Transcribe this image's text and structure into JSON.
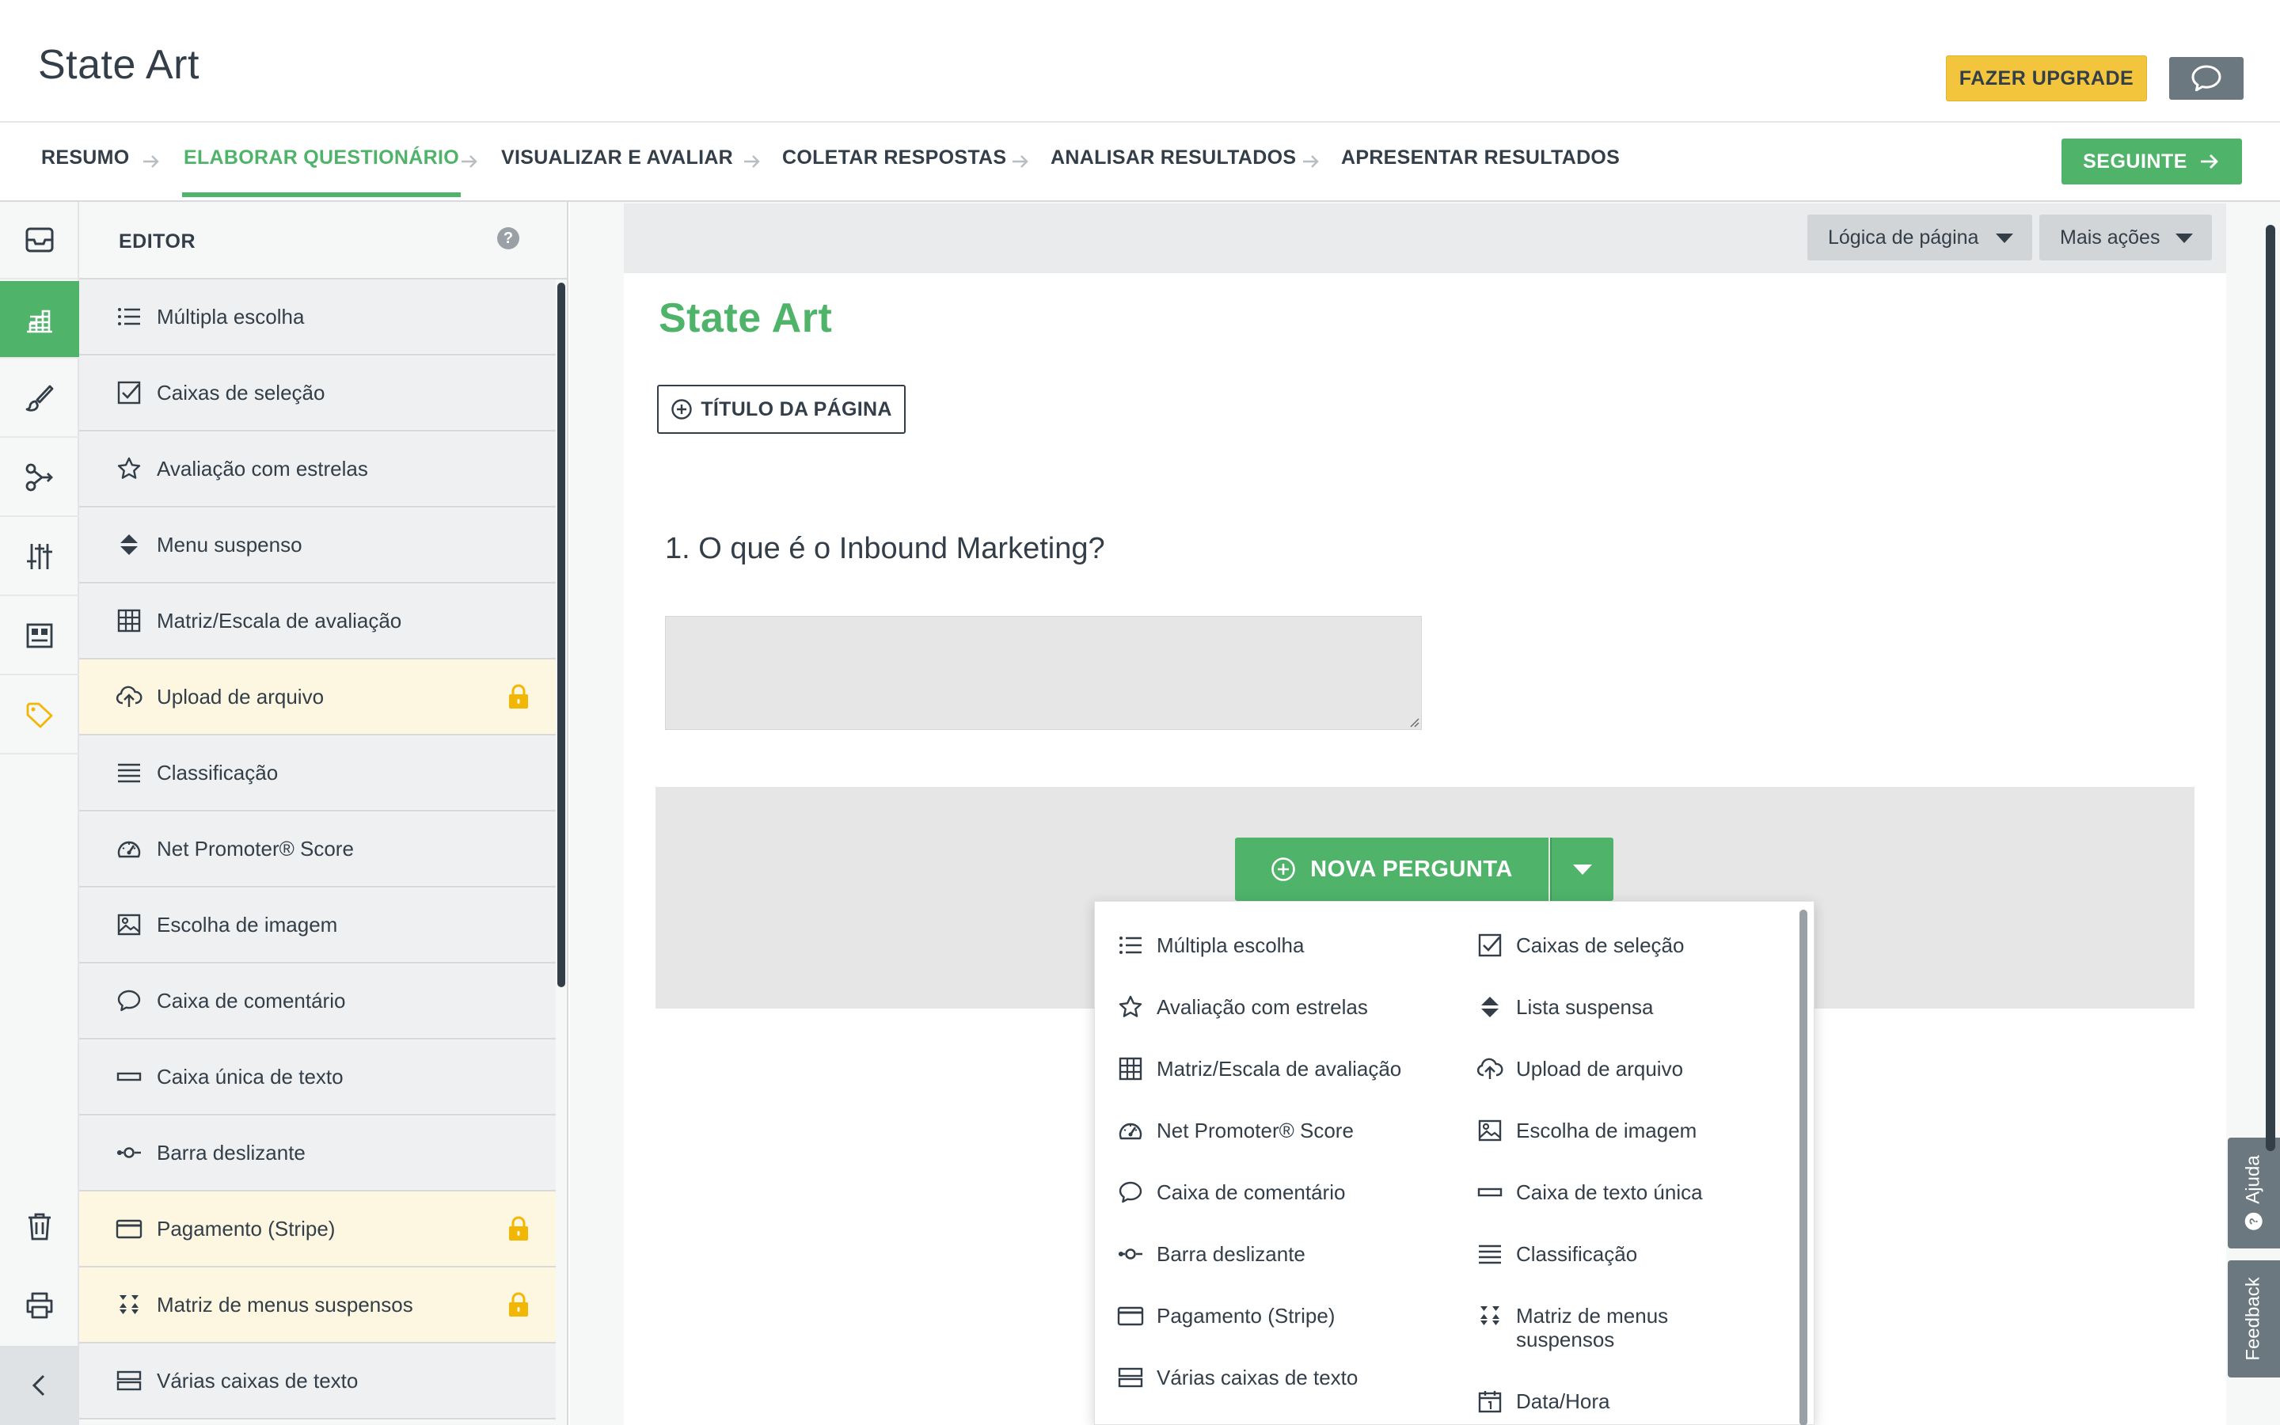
{
  "app": {
    "title": "State Art",
    "upgrade_label": "FAZER UPGRADE",
    "chat_icon": "chat-bubble-icon"
  },
  "steps": [
    {
      "label": "RESUMO",
      "active": false
    },
    {
      "label": "ELABORAR QUESTIONÁRIO",
      "active": true
    },
    {
      "label": "VISUALIZAR E AVALIAR",
      "active": false
    },
    {
      "label": "COLETAR RESPOSTAS",
      "active": false
    },
    {
      "label": "ANALISAR RESULTADOS",
      "active": false
    },
    {
      "label": "APRESENTAR RESULTADOS",
      "active": false
    }
  ],
  "next_label": "SEGUINTE",
  "rail": {
    "items": [
      "inbox-icon",
      "builder-icon",
      "brush-icon",
      "logic-icon",
      "sliders-icon",
      "layout-icon",
      "tag-icon"
    ],
    "bottom": [
      "trash-icon",
      "print-icon",
      "collapse-icon"
    ]
  },
  "editor": {
    "title": "EDITOR",
    "help": "?",
    "items": [
      {
        "label": "Múltipla escolha",
        "icon": "list-icon",
        "locked": false
      },
      {
        "label": "Caixas de seleção",
        "icon": "checkbox-icon",
        "locked": false
      },
      {
        "label": "Avaliação com estrelas",
        "icon": "star-icon",
        "locked": false
      },
      {
        "label": "Menu suspenso",
        "icon": "dropdown-icon",
        "locked": false
      },
      {
        "label": "Matriz/Escala de avaliação",
        "icon": "grid-icon",
        "locked": false
      },
      {
        "label": "Upload de arquivo",
        "icon": "cloud-upload-icon",
        "locked": true
      },
      {
        "label": "Classificação",
        "icon": "ranking-icon",
        "locked": false
      },
      {
        "label": "Net Promoter® Score",
        "icon": "gauge-icon",
        "locked": false
      },
      {
        "label": "Escolha de imagem",
        "icon": "image-icon",
        "locked": false
      },
      {
        "label": "Caixa de comentário",
        "icon": "comment-icon",
        "locked": false
      },
      {
        "label": "Caixa única de texto",
        "icon": "textbox-icon",
        "locked": false
      },
      {
        "label": "Barra deslizante",
        "icon": "slider-icon",
        "locked": false
      },
      {
        "label": "Pagamento (Stripe)",
        "icon": "card-icon",
        "locked": true
      },
      {
        "label": "Matriz de menus suspensos",
        "icon": "dropdown-matrix-icon",
        "locked": true
      },
      {
        "label": "Várias caixas de texto",
        "icon": "multi-textbox-icon",
        "locked": false
      }
    ]
  },
  "canvas": {
    "page_logic_label": "Lógica de página",
    "more_actions_label": "Mais ações",
    "survey_title": "State Art",
    "page_title_label": "TÍTULO DA PÁGINA",
    "question": "1. O que é o Inbound Marketing?",
    "new_question_label": "NOVA PERGUNTA"
  },
  "menu": {
    "left": [
      {
        "label": "Múltipla escolha",
        "icon": "list-icon"
      },
      {
        "label": "Avaliação com estrelas",
        "icon": "star-icon"
      },
      {
        "label": "Matriz/Escala de avaliação",
        "icon": "grid-icon"
      },
      {
        "label": "Net Promoter® Score",
        "icon": "gauge-icon"
      },
      {
        "label": "Caixa de comentário",
        "icon": "comment-icon"
      },
      {
        "label": "Barra deslizante",
        "icon": "slider-icon"
      },
      {
        "label": "Pagamento (Stripe)",
        "icon": "card-icon"
      },
      {
        "label": "Várias caixas de texto",
        "icon": "multi-textbox-icon"
      }
    ],
    "right": [
      {
        "label": "Caixas de seleção",
        "icon": "checkbox-icon"
      },
      {
        "label": "Lista suspensa",
        "icon": "dropdown-icon"
      },
      {
        "label": "Upload de arquivo",
        "icon": "cloud-upload-icon"
      },
      {
        "label": "Escolha de imagem",
        "icon": "image-icon"
      },
      {
        "label": "Caixa de texto única",
        "icon": "textbox-icon"
      },
      {
        "label": "Classificação",
        "icon": "ranking-icon"
      },
      {
        "label": "Matriz de menus suspensos",
        "icon": "dropdown-matrix-icon"
      },
      {
        "label": "Data/Hora",
        "icon": "calendar-icon"
      }
    ]
  },
  "side_tabs": {
    "help_label": "Ajuda",
    "feedback_label": "Feedback"
  },
  "colors": {
    "accent": "#4fb36a",
    "upgrade": "#f2c53d",
    "text": "#333e48",
    "locked_bg": "#fdf7e1",
    "lock": "#f2b705",
    "tab_gray": "#6b787f"
  }
}
